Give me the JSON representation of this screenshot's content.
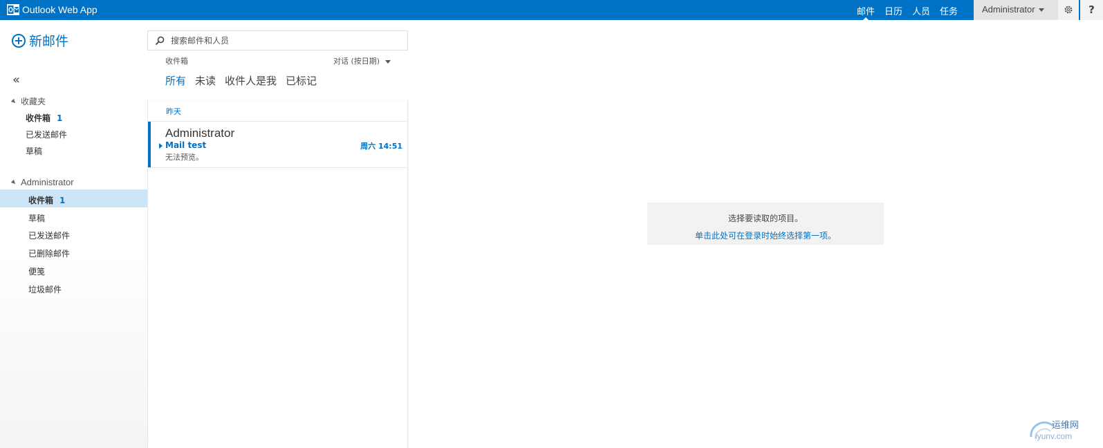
{
  "topbar": {
    "app_title": "Outlook Web App",
    "nav": [
      "邮件",
      "日历",
      "人员",
      "任务"
    ],
    "user": "Administrator",
    "settings_icon": "gear-icon",
    "help_label": "?",
    "accent": "#0072c6"
  },
  "leftnav": {
    "new_mail": "新邮件",
    "collapse": "«",
    "favorites": {
      "title": "收藏夹",
      "items": [
        {
          "label": "收件箱",
          "count": "1"
        },
        {
          "label": "已发送邮件"
        },
        {
          "label": "草稿"
        }
      ]
    },
    "account": {
      "title": "Administrator",
      "items": [
        {
          "label": "收件箱",
          "count": "1"
        },
        {
          "label": "草稿"
        },
        {
          "label": "已发送邮件"
        },
        {
          "label": "已删除邮件"
        },
        {
          "label": "便笺"
        },
        {
          "label": "垃圾邮件"
        }
      ]
    }
  },
  "list": {
    "search_placeholder": "搜索邮件和人员",
    "folder_title": "收件箱",
    "sort_label": "对话 (按日期)",
    "filters": [
      "所有",
      "未读",
      "收件人是我",
      "已标记"
    ],
    "group": "昨天",
    "messages": [
      {
        "from": "Administrator",
        "subject": "Mail test",
        "time": "周六 14:51",
        "preview": "无法预览。"
      }
    ]
  },
  "reading": {
    "line1": "选择要读取的项目。",
    "line2": "单击此处可在登录时始终选择第一项。"
  },
  "watermark": {
    "line1": "运维网",
    "line2": "iyunv.com"
  }
}
